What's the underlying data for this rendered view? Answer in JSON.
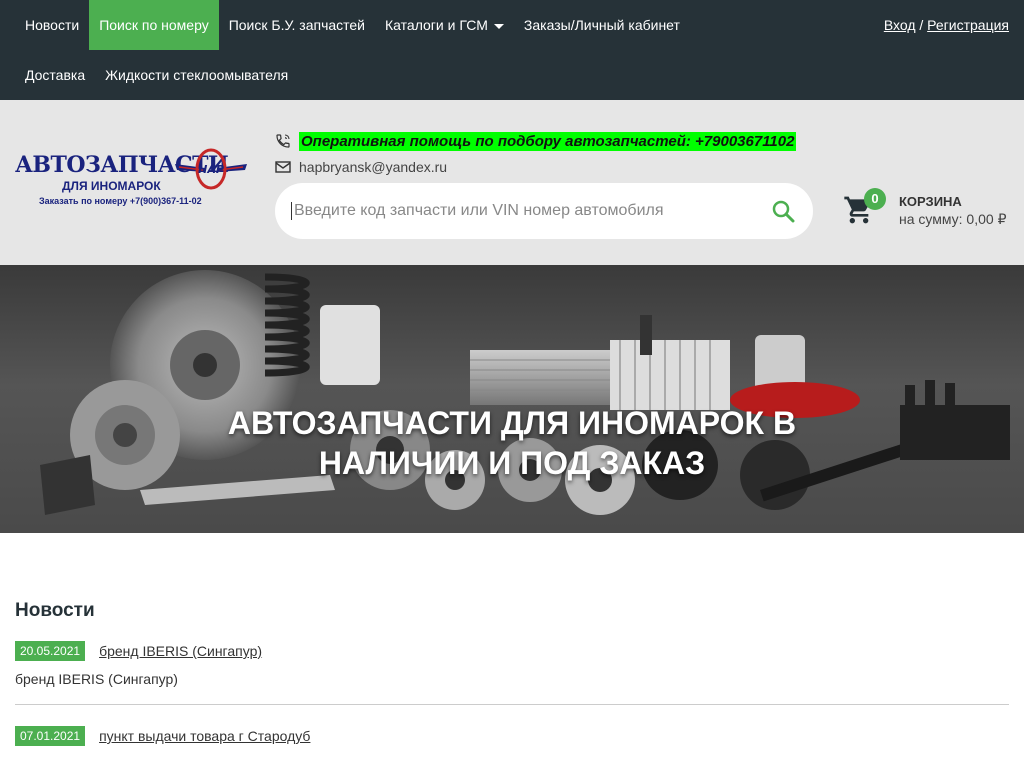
{
  "nav": {
    "row1": [
      {
        "label": "Новости",
        "active": false
      },
      {
        "label": "Поиск по номеру",
        "active": true
      },
      {
        "label": "Поиск Б.У. запчастей",
        "active": false
      },
      {
        "label": "Каталоги и ГСМ",
        "active": false,
        "dropdown": true
      },
      {
        "label": "Заказы/Личный кабинет",
        "active": false
      }
    ],
    "row2": [
      {
        "label": "Доставка"
      },
      {
        "label": "Жидкости стеклоомывателя"
      }
    ],
    "login": "Вход",
    "separator": " / ",
    "register": "Регистрация"
  },
  "logo": {
    "main": "АВТОЗАПЧАСТИ",
    "sub": "ДЛЯ ИНОМАРОК",
    "phone": "Заказать по номеру +7(900)367-11-02",
    "emblem": "НАР"
  },
  "header": {
    "help": "Оперативная помощь по подбору автозапчастей: +79003671102",
    "email": "hapbryansk@yandex.ru",
    "search_placeholder": "Введите код запчасти или VIN номер автомобиля"
  },
  "cart": {
    "count": "0",
    "title": "КОРЗИНА",
    "sum": "на сумму: 0,00 ₽"
  },
  "banner": {
    "title_line1": "АВТОЗАПЧАСТИ ДЛЯ ИНОМАРОК В",
    "title_line2": "НАЛИЧИИ И ПОД ЗАКАЗ"
  },
  "news": {
    "heading": "Новости",
    "items": [
      {
        "date": "20.05.2021",
        "title": "бренд IBERIS (Сингапур)",
        "desc": "бренд IBERIS (Сингапур)"
      },
      {
        "date": "07.01.2021",
        "title": "пункт выдачи товара г Стародуб"
      }
    ]
  },
  "colors": {
    "nav_bg": "#263238",
    "accent": "#4caf50",
    "header_bg": "#e6e6e6",
    "highlight": "#00ff00",
    "brand_blue": "#1a237e"
  }
}
